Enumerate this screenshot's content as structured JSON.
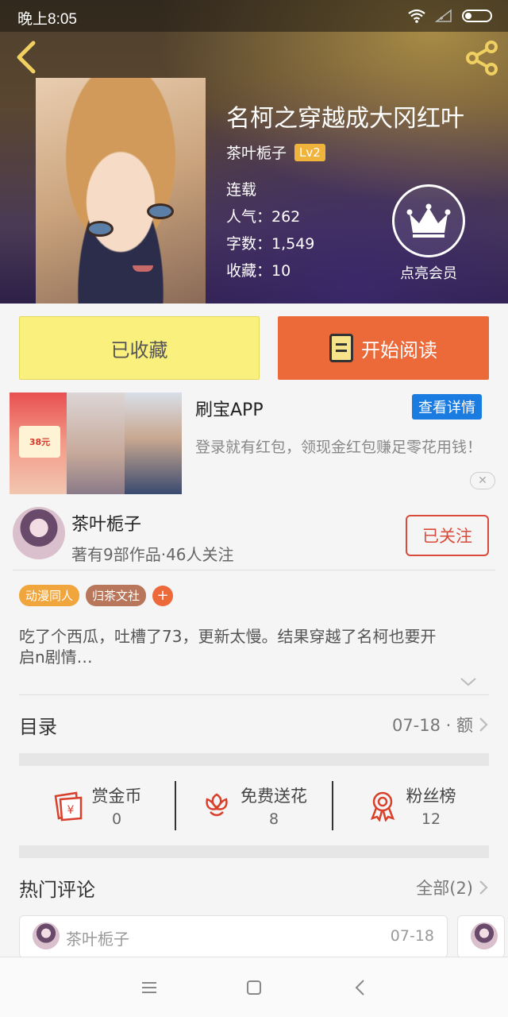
{
  "status": {
    "time": "晚上8:05"
  },
  "book": {
    "title": "名柯之穿越成大冈红叶",
    "author": "茶叶栀子",
    "level": "Lv2",
    "state": "连载",
    "popularity": "人气：262",
    "words": "字数：1,549",
    "favorites": "收藏：10",
    "vip_label": "点亮会员"
  },
  "actions": {
    "fav_label": "已收藏",
    "read_label": "开始阅读"
  },
  "ad": {
    "title": "刷宝APP",
    "detail_label": "查看详情",
    "description": "登录就有红包，领现金红包赚足零花用钱！",
    "card_amount": "38元"
  },
  "author_card": {
    "name": "茶叶栀子",
    "stats": "著有9部作品·46人关注",
    "follow_label": "已关注"
  },
  "tags": [
    {
      "label": "动漫同人",
      "color": "#f0a63c"
    },
    {
      "label": "归茶文社",
      "color": "#b8765a"
    }
  ],
  "tag_add": "+",
  "intro": "吃了个西瓜，吐槽了73，更新太慢。结果穿越了名柯也要开启n剧情…",
  "catalog": {
    "title": "目录",
    "latest": "07-18 · 额"
  },
  "stats": [
    {
      "label": "赏金币",
      "value": "0",
      "icon": "red-envelope-icon"
    },
    {
      "label": "免费送花",
      "value": "8",
      "icon": "flower-icon"
    },
    {
      "label": "粉丝榜",
      "value": "12",
      "icon": "ribbon-icon"
    }
  ],
  "comments": {
    "title": "热门评论",
    "all_label": "全部(2)",
    "first": {
      "author": "茶叶栀子",
      "date": "07-18"
    }
  },
  "colors": {
    "accent": "#ec6a3a",
    "fav_bg": "#faf07e",
    "follow": "#d94a3a",
    "ad_button": "#1a7be0"
  }
}
